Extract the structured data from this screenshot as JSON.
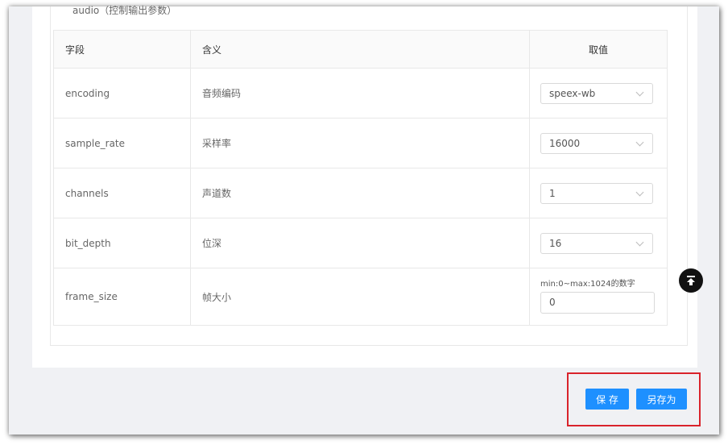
{
  "section": {
    "title": "audio（控制输出参数）"
  },
  "table": {
    "headers": [
      "字段",
      "含义",
      "取值"
    ],
    "rows": [
      {
        "field": "encoding",
        "meaning": "音频编码",
        "value": "speex-wb"
      },
      {
        "field": "sample_rate",
        "meaning": "采样率",
        "value": "16000"
      },
      {
        "field": "channels",
        "meaning": "声道数",
        "value": "1"
      },
      {
        "field": "bit_depth",
        "meaning": "位深",
        "value": "16"
      }
    ],
    "frame_size": {
      "field": "frame_size",
      "meaning": "帧大小",
      "hint": "min:0~max:1024的数字",
      "value": "0"
    }
  },
  "actions": {
    "save_label": "保 存",
    "save_as_label": "另存为"
  },
  "icons": {
    "back_to_top": "arrow-up-to-line-icon",
    "select_chevron": "chevron-down-icon"
  },
  "colors": {
    "primary": "#1e90ff",
    "highlight": "#d9232b",
    "back_top_bg": "#111111"
  }
}
